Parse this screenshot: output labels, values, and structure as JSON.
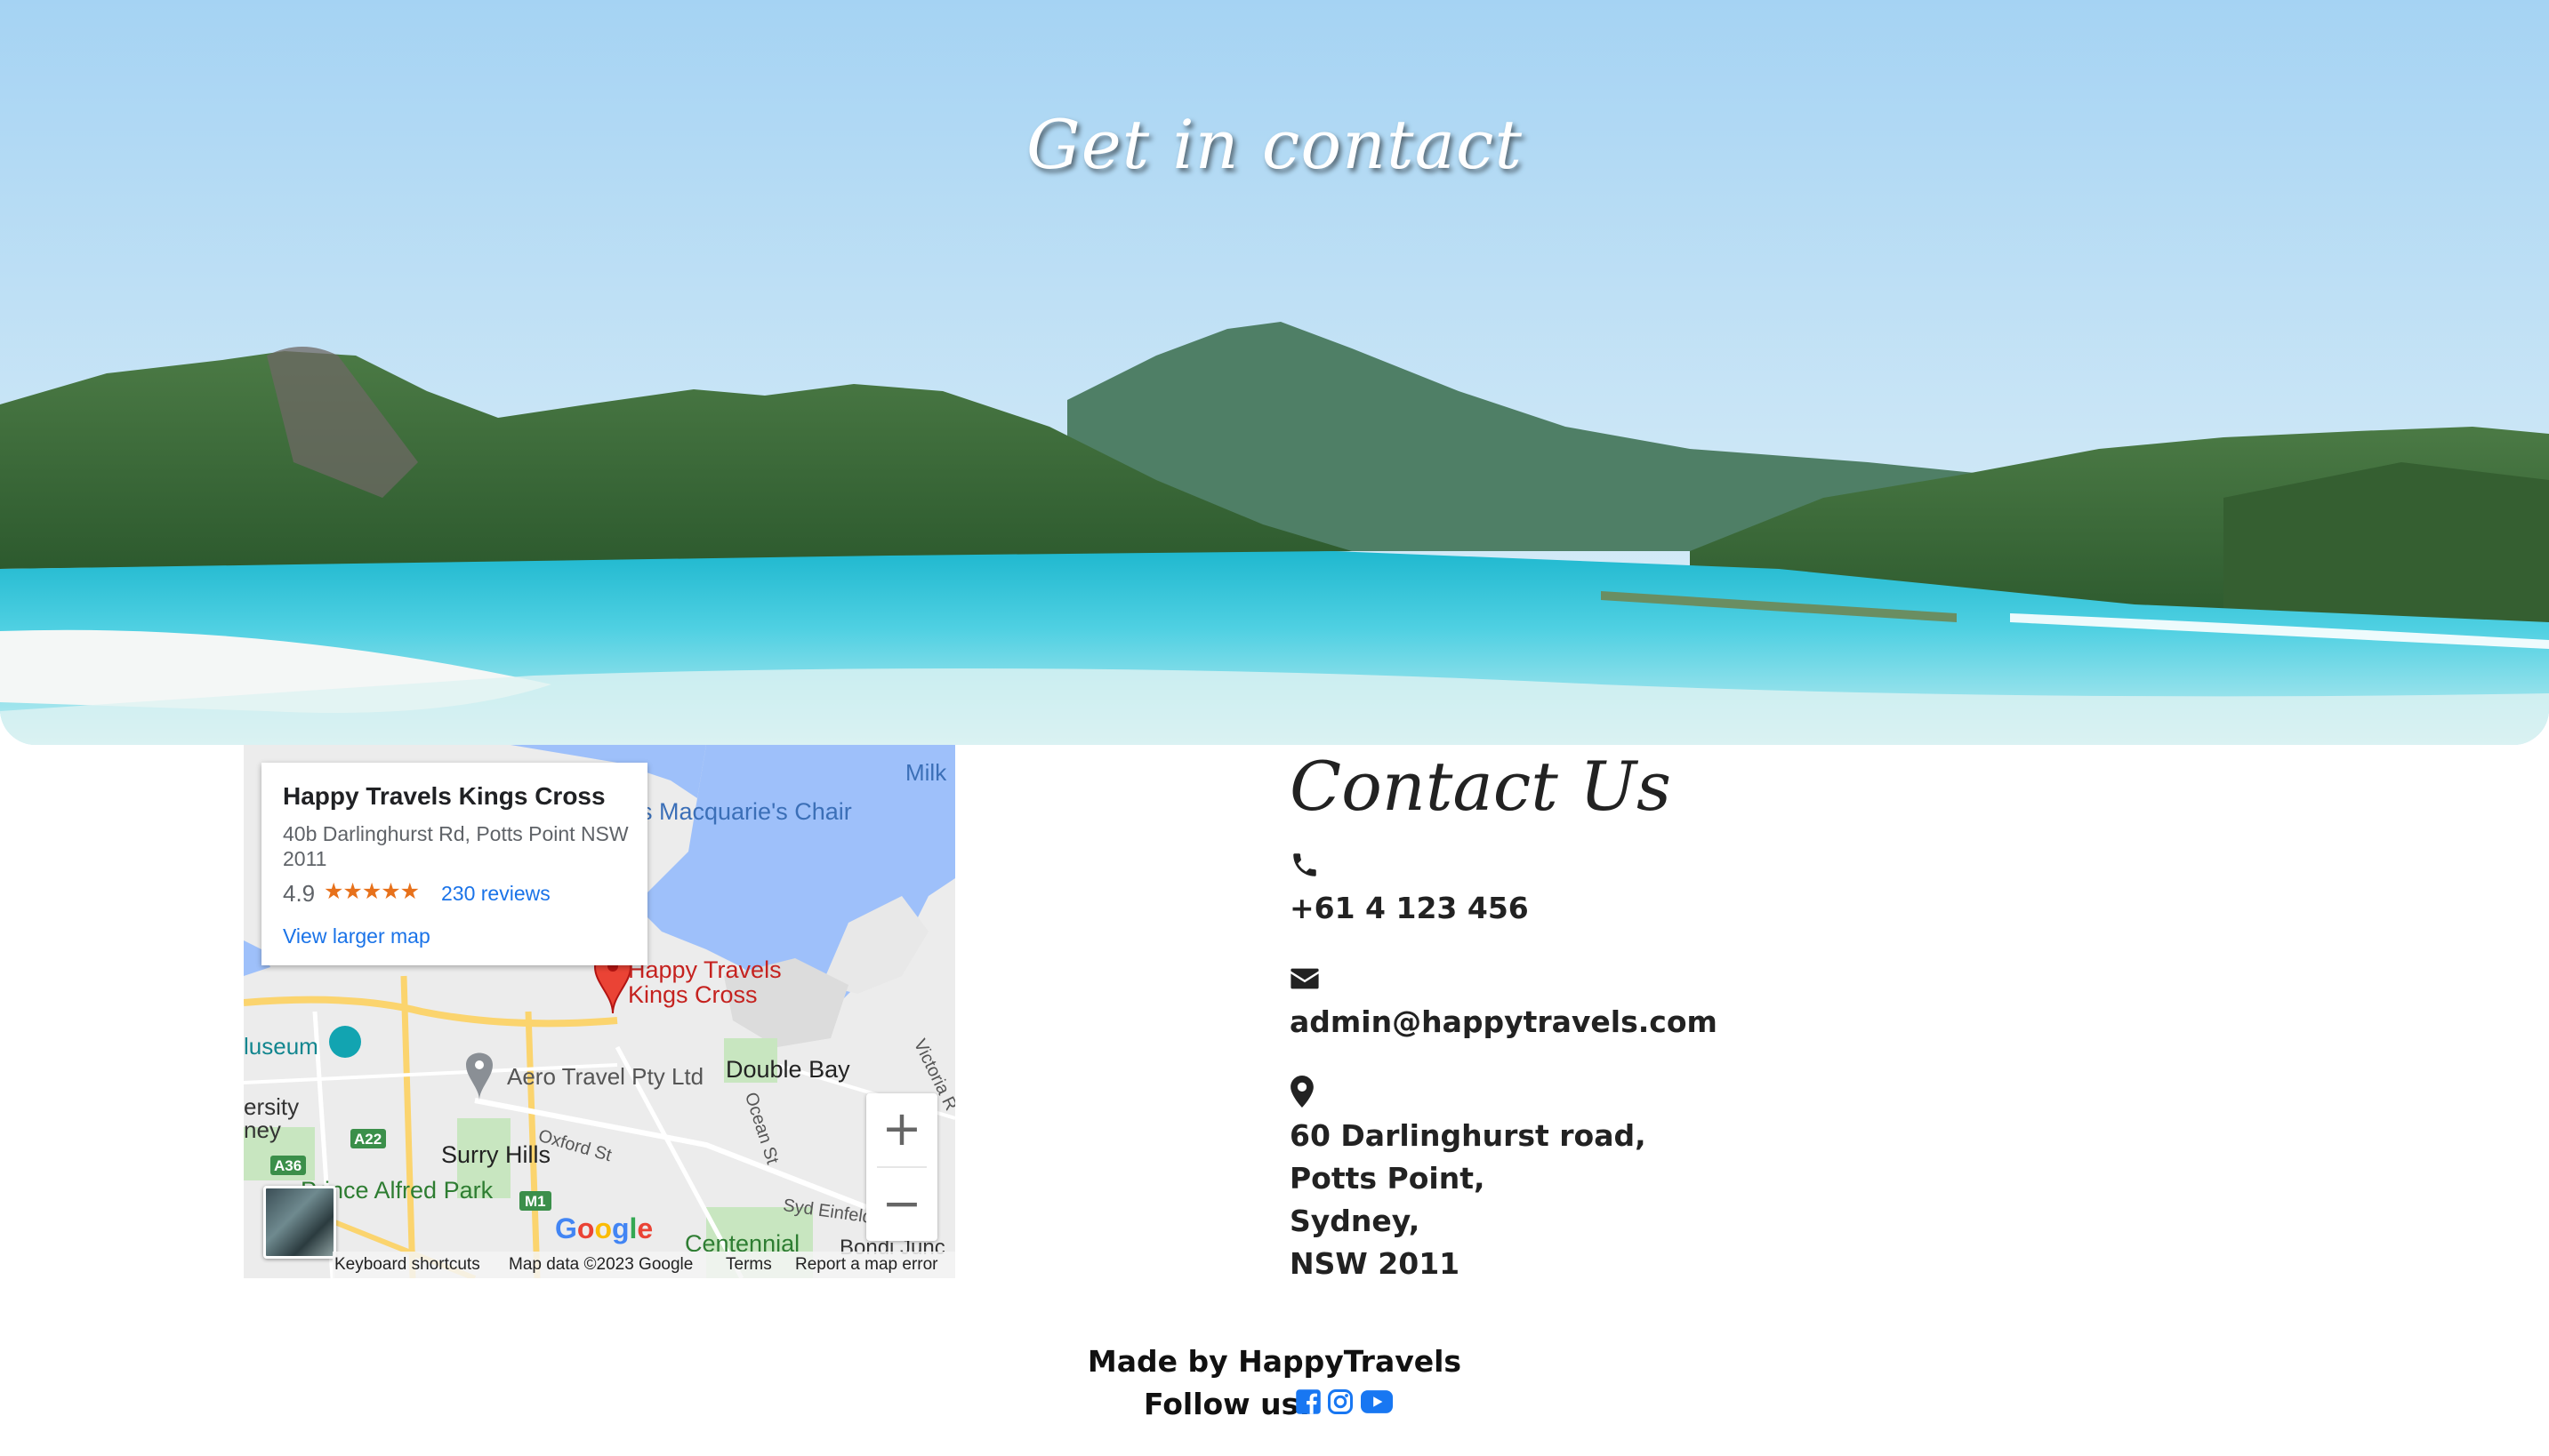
{
  "hero": {
    "title": "Get in contact"
  },
  "map": {
    "place_name": "Happy Travels Kings Cross",
    "address": "40b Darlinghurst Rd, Potts Point NSW 2011",
    "rating": "4.9",
    "stars": "★★★★★",
    "reviews": "230 reviews",
    "view_larger": "View larger map",
    "pin_label_line1": "Happy Travels",
    "pin_label_line2": "Kings Cross",
    "labels": {
      "milk": "Milk",
      "macquarie": "s Macquarie's Chair",
      "museum": "luseum",
      "aero": "Aero Travel Pty Ltd",
      "double_bay": "Double Bay",
      "ersity": "ersity",
      "ney": "ney",
      "surry_hills": "Surry Hills",
      "oxford": "Oxford St",
      "ocean": "Ocean St",
      "victoria": "Victoria R",
      "prince_alfred": "Prince Alfred Park",
      "syd_einfeld": "Syd Einfeld",
      "centennial": "Centennial",
      "bondi": "Bondi Junc",
      "a22": "A22",
      "a36": "A36",
      "m1": "M1",
      "google": "Google"
    },
    "zoom_in": "+",
    "zoom_out": "−",
    "footer": {
      "shortcuts": "Keyboard shortcuts",
      "map_data": "Map data ©2023 Google",
      "terms": "Terms",
      "report": "Report a map error"
    }
  },
  "contact": {
    "title": "Contact Us",
    "phone": "+61 4 123 456",
    "email": "admin@happytravels.com",
    "address_lines": [
      "60 Darlinghurst road,",
      "Potts Point,",
      "Sydney,",
      "NSW 2011"
    ]
  },
  "footer": {
    "made_by": "Made by HappyTravels",
    "follow": "Follow us:"
  },
  "colors": {
    "social_blue": "#1877f2",
    "map_water": "#9ec0fa",
    "pin_red": "#ea4335"
  },
  "icons": [
    "phone-icon",
    "envelope-icon",
    "map-marker-icon",
    "facebook-icon",
    "instagram-icon",
    "youtube-icon"
  ]
}
